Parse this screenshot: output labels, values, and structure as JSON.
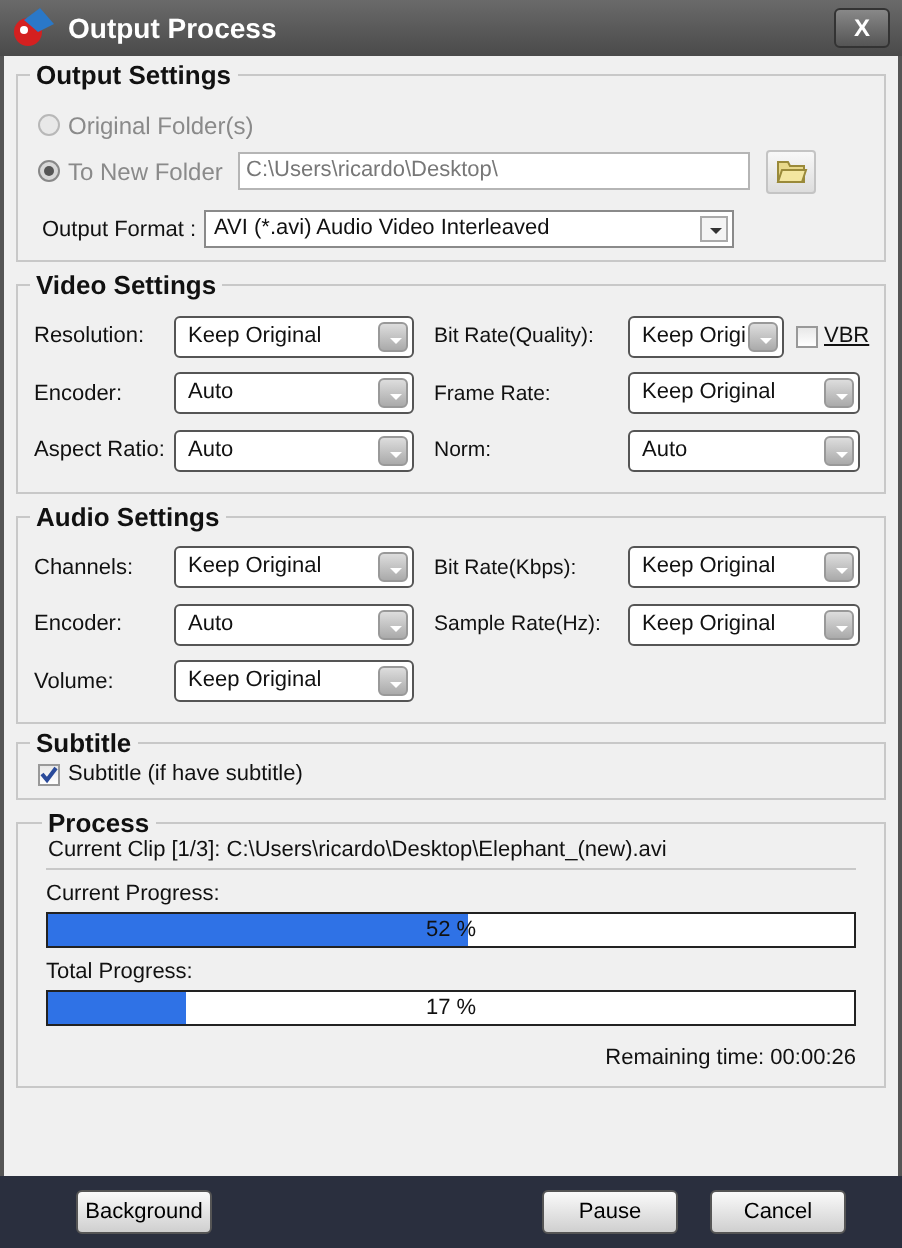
{
  "window": {
    "title": "Output Process",
    "close": "X"
  },
  "output_settings": {
    "title": "Output Settings",
    "options": [
      {
        "label": "Original Folder(s)",
        "selected": false,
        "disabled": true
      },
      {
        "label": "To New Folder",
        "selected": true,
        "disabled": true
      }
    ],
    "folder": {
      "value": "C:\\Users\\ricardo\\Desktop\\",
      "disabled": true
    },
    "format_label": "Output Format :",
    "format_value": "AVI  (*.avi) Audio Video Interleaved"
  },
  "video_settings": {
    "title": "Video Settings",
    "rows": [
      [
        {
          "label": "Resolution:",
          "value": "Keep Original"
        },
        {
          "label": "Bit Rate(Quality):",
          "value": "Keep Origi",
          "checkbox": {
            "label": "VBR",
            "checked": false
          }
        }
      ],
      [
        {
          "label": "Encoder:",
          "value": "Auto"
        },
        {
          "label": "Frame Rate:",
          "value": "Keep Original"
        }
      ],
      [
        {
          "label": "Aspect Ratio:",
          "value": "Auto"
        },
        {
          "label": "Norm:",
          "value": "Auto"
        }
      ]
    ]
  },
  "audio_settings": {
    "title": "Audio Settings",
    "rows": [
      [
        {
          "label": "Channels:",
          "value": "Keep Original"
        },
        {
          "label": "Bit Rate(Kbps):",
          "value": "Keep Original"
        }
      ],
      [
        {
          "label": "Encoder:",
          "value": "Auto"
        },
        {
          "label": "Sample Rate(Hz):",
          "value": "Keep Original"
        }
      ],
      [
        {
          "label": "Volume:",
          "value": "Keep Original"
        }
      ]
    ]
  },
  "subtitle": {
    "title": "Subtitle",
    "label": "Subtitle (if have subtitle)",
    "checked": true
  },
  "process": {
    "title": "Process",
    "current_clip": "Current Clip [1/3]: C:\\Users\\ricardo\\Desktop\\Elephant_(new).avi",
    "bars": [
      {
        "label": "Current Progress:",
        "level": 0.52,
        "reading": "52 %"
      },
      {
        "label": "Total Progress:",
        "level": 0.17,
        "reading": "17 %"
      }
    ],
    "remaining": "Remaining time: 00:00:26"
  },
  "buttons": [
    {
      "label": "Background"
    },
    {
      "label": "Pause"
    },
    {
      "label": "Cancel"
    }
  ]
}
